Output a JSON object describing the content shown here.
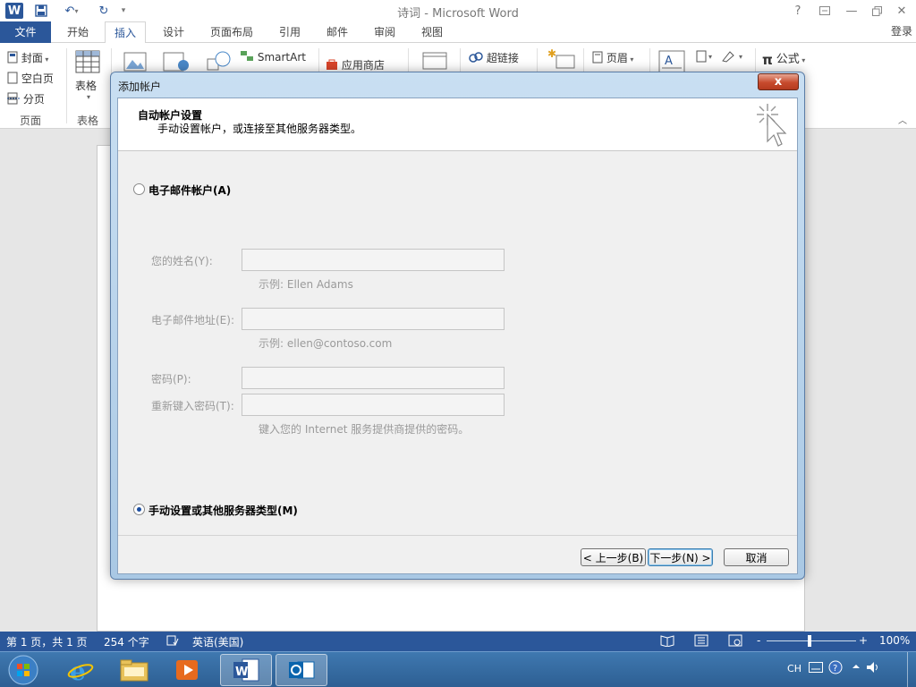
{
  "window": {
    "title": "诗词 - Microsoft Word",
    "logo": "W",
    "help": "?",
    "login": "登录"
  },
  "tabs": [
    {
      "label": "文件",
      "kind": "file"
    },
    {
      "label": "开始"
    },
    {
      "label": "插入",
      "active": true
    },
    {
      "label": "设计"
    },
    {
      "label": "页面布局"
    },
    {
      "label": "引用"
    },
    {
      "label": "邮件"
    },
    {
      "label": "审阅"
    },
    {
      "label": "视图"
    }
  ],
  "ribbon": {
    "pages_group": {
      "label": "页面",
      "cover": "封面",
      "blank": "空白页",
      "break": "分页"
    },
    "tables_group": {
      "label": "表格",
      "table": "表格"
    },
    "smartart": "SmartArt",
    "app_store": "应用商店",
    "hyperlink": "超链接",
    "header": "页眉",
    "equation": "公式",
    "pi": "π"
  },
  "dialog": {
    "title": "添加帐户",
    "close": "x",
    "header_title": "自动帐户设置",
    "header_subtitle": "手动设置帐户，或连接至其他服务器类型。",
    "option_email": "电子邮件帐户(A)",
    "option_manual": "手动设置或其他服务器类型(M)",
    "selected_option": "manual",
    "fields": {
      "name_label": "您的姓名(Y):",
      "name_hint": "示例: Ellen Adams",
      "email_label": "电子邮件地址(E):",
      "email_hint": "示例: ellen@contoso.com",
      "password_label": "密码(P):",
      "retype_label": "重新键入密码(T):",
      "password_hint": "键入您的 Internet 服务提供商提供的密码。"
    },
    "buttons": {
      "back": "< 上一步(B)",
      "next": "下一步(N) >",
      "cancel": "取消"
    }
  },
  "statusbar": {
    "page": "第 1 页，共 1 页",
    "words": "254 个字",
    "language": "英语(美国)",
    "zoom": "100%",
    "zoom_level": 1.0,
    "minus": "-",
    "plus": "+"
  },
  "taskbar": {
    "items": [
      "start",
      "internet-explorer",
      "file-explorer",
      "media-player",
      "word",
      "outlook"
    ],
    "active": [
      "word",
      "outlook"
    ],
    "tray_lang": "CH"
  },
  "colors": {
    "word_blue": "#2b579a",
    "dialog_frame": "#a9c8e4",
    "close_red": "#c74a2d"
  }
}
